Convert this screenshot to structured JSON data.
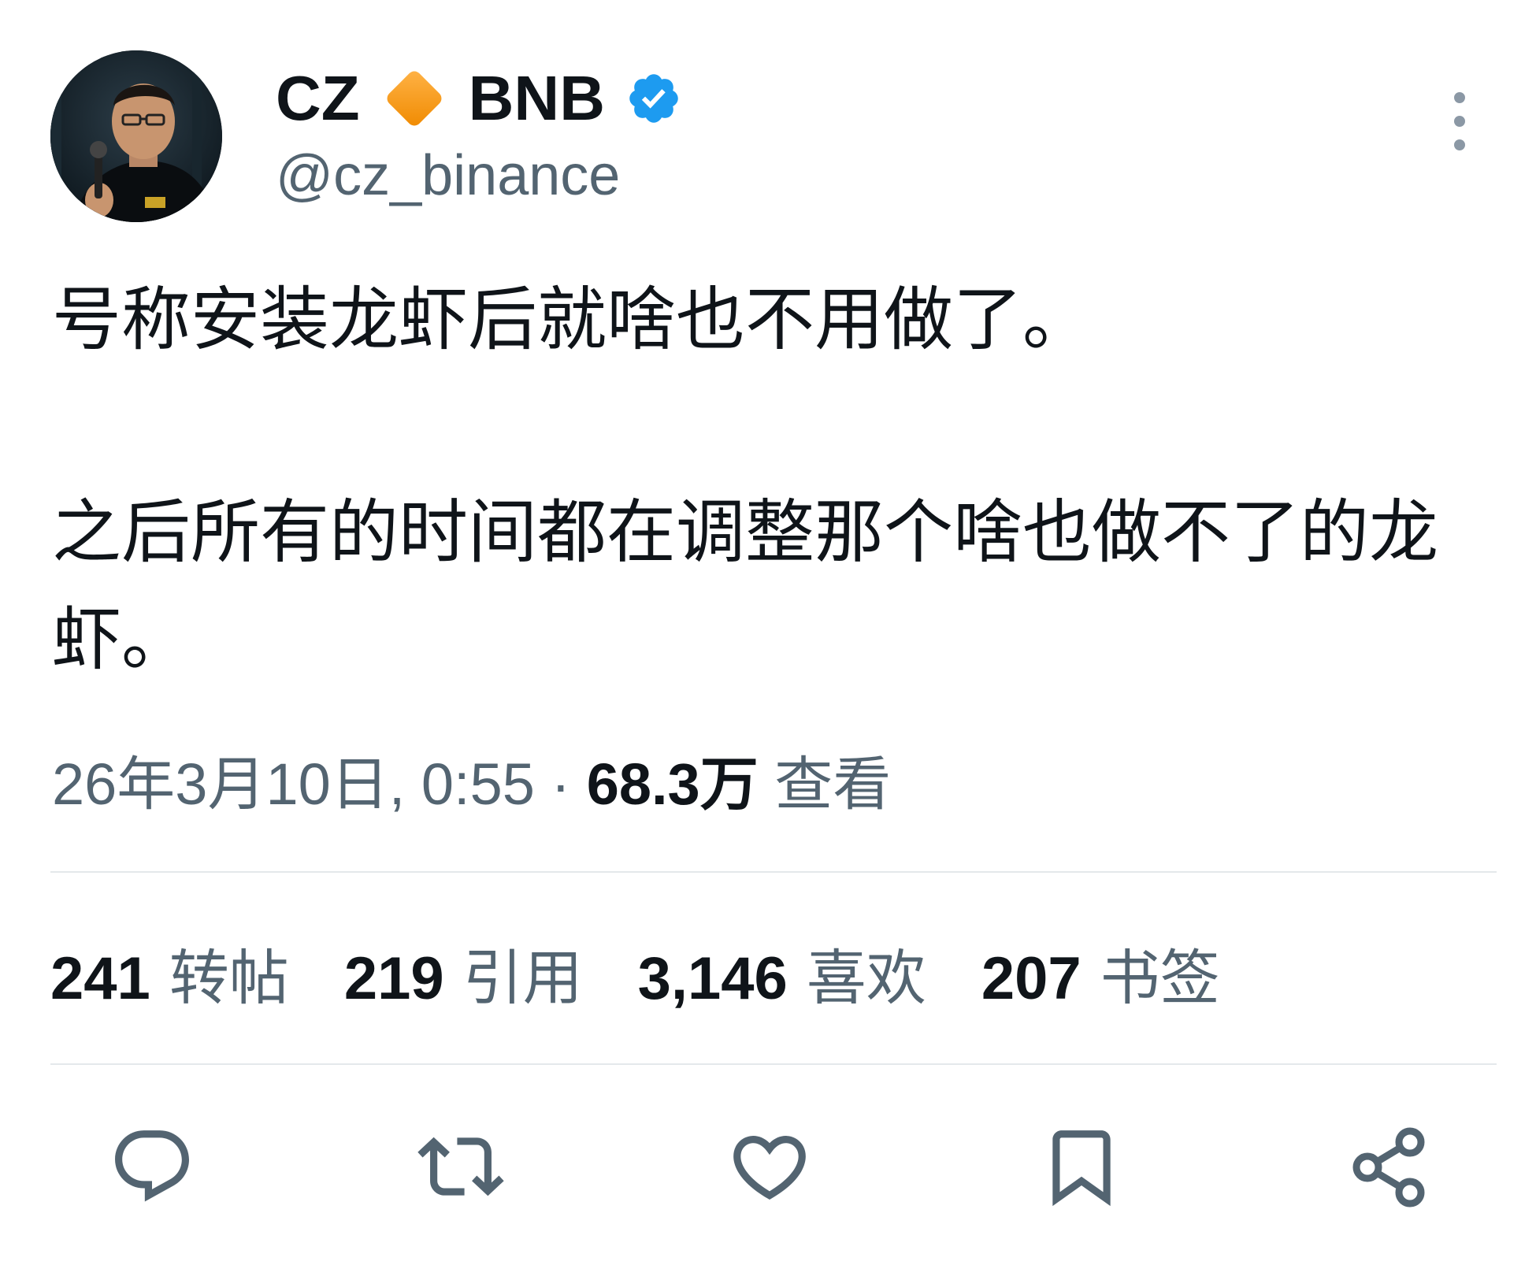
{
  "author": {
    "name_first": "CZ",
    "name_last": "BNB",
    "handle": "@cz_binance",
    "icons": {
      "diamond": "orange-diamond-icon",
      "verified": "verified-badge-icon",
      "more": "more-options-icon"
    }
  },
  "tweet": {
    "paragraph_1": "号称安装龙虾后就啥也不用做了。",
    "paragraph_2": "之后所有的时间都在调整那个啥也做不了的龙虾。"
  },
  "meta": {
    "timestamp": "26年3月10日, 0:55",
    "separator": " · ",
    "views_count": "68.3万",
    "views_label": "查看"
  },
  "stats": {
    "reposts_count": "241",
    "reposts_label": "转帖",
    "quotes_count": "219",
    "quotes_label": "引用",
    "likes_count": "3,146",
    "likes_label": "喜欢",
    "bookmarks_count": "207",
    "bookmarks_label": "书签"
  },
  "actions": [
    "reply-icon",
    "retweet-icon",
    "like-icon",
    "bookmark-icon",
    "share-icon"
  ],
  "colors": {
    "text_primary": "#0f1419",
    "text_secondary": "#536471",
    "verified_blue": "#1d9bf0",
    "diamond_orange": "#f7931a",
    "divider": "#e4e8eb"
  }
}
